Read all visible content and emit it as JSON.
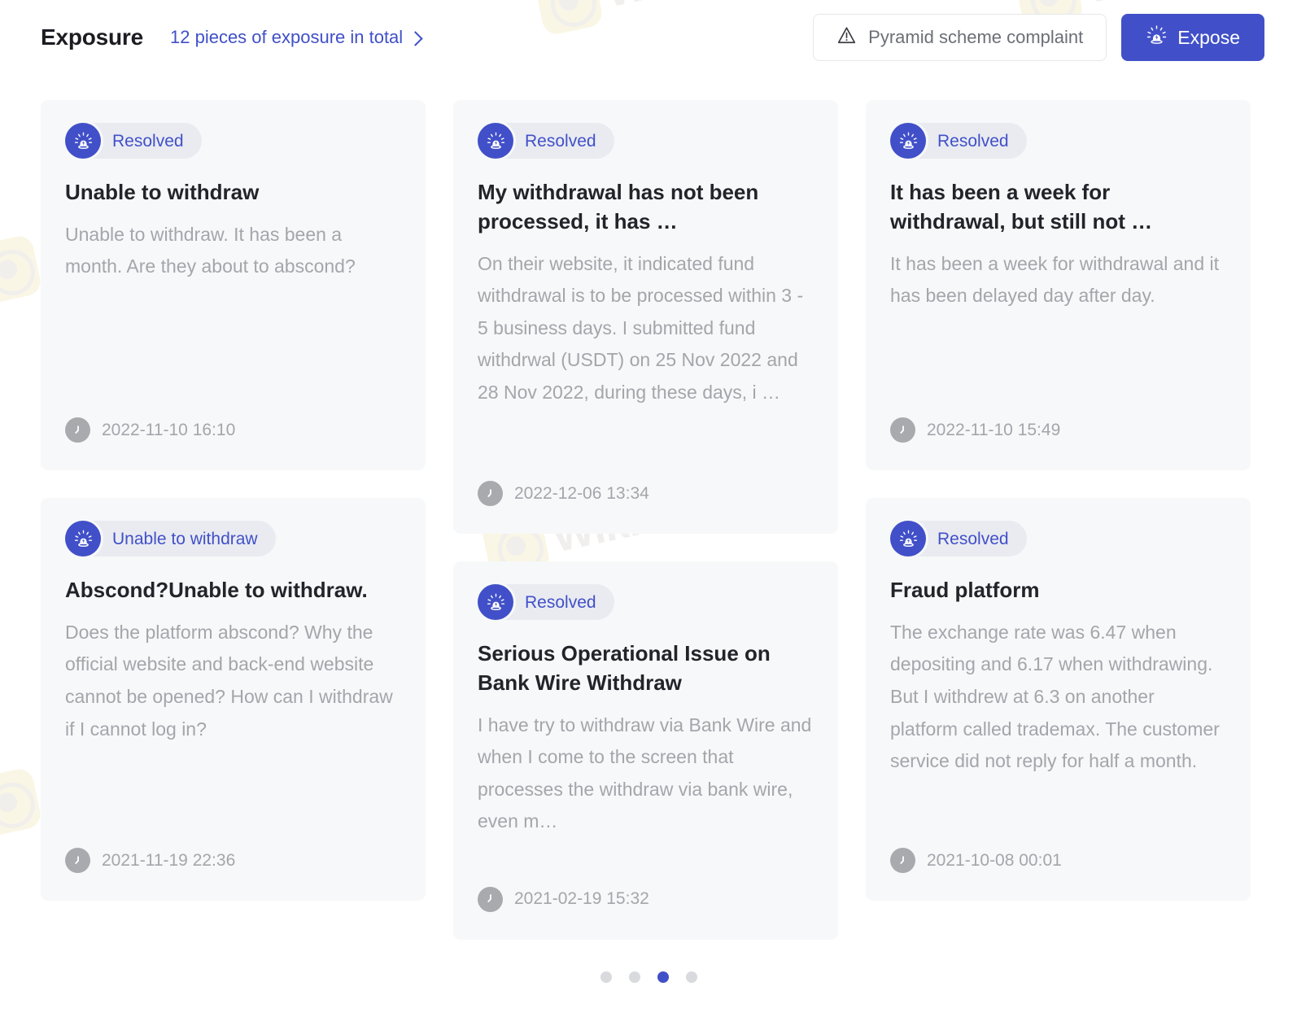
{
  "header": {
    "title": "Exposure",
    "total_link": "12 pieces of exposure in total",
    "chevron_icon": "chevron-right-icon",
    "pyramid_button": {
      "label": "Pyramid scheme complaint",
      "icon": "warning-triangle-icon"
    },
    "expose_button": {
      "label": "Expose",
      "icon": "siren-alarm-icon"
    }
  },
  "colors": {
    "accent": "#4150c8",
    "card_bg": "#f7f8f9",
    "badge_bg": "#e9ebf1",
    "muted_text": "#a3a6ab",
    "title_text": "#23242a",
    "page_bg": "#ffffff",
    "dot_inactive": "#d9dadd"
  },
  "cards": [
    {
      "badge": "Resolved",
      "badge_icon": "siren-alarm-icon",
      "title": "Unable to withdraw",
      "body": "Unable to withdraw. It has been a month. Are they about to abscond?",
      "time": "2022-11-10 16:10",
      "time_icon": "clock-icon"
    },
    {
      "badge": "Unable to withdraw",
      "badge_icon": "siren-alarm-icon",
      "title": "Abscond?Unable to withdraw.",
      "body": "Does the platform abscond? Why the official website and back-end website cannot be opened? How can I withdraw if I cannot log in?",
      "time": "2021-11-19 22:36",
      "time_icon": "clock-icon"
    },
    {
      "badge": "Resolved",
      "badge_icon": "siren-alarm-icon",
      "title": "My withdrawal has not been processed, it has …",
      "body": "On their website, it indicated fund withdrawal is to be processed within 3 - 5 business days. I submitted fund withdrwal (USDT) on 25 Nov 2022 and 28 Nov 2022, during these days, i …",
      "time": "2022-12-06 13:34",
      "time_icon": "clock-icon"
    },
    {
      "badge": "Resolved",
      "badge_icon": "siren-alarm-icon",
      "title": "Serious Operational Issue on Bank Wire Withdraw",
      "body": "I have try to withdraw via Bank Wire and when I come to the screen that processes the withdraw via bank wire, even m…",
      "time": "2021-02-19 15:32",
      "time_icon": "clock-icon"
    },
    {
      "badge": "Resolved",
      "badge_icon": "siren-alarm-icon",
      "title": "It has been a week for withdrawal, but still not …",
      "body": "It has been a week for withdrawal and it has been delayed day after day.",
      "time": "2022-11-10 15:49",
      "time_icon": "clock-icon"
    },
    {
      "badge": "Resolved",
      "badge_icon": "siren-alarm-icon",
      "title": "Fraud platform",
      "body": "The exchange rate was 6.47 when depositing and 6.17 when withdrawing. But I withdrew at 6.3 on another platform called trademax. The customer service did not reply for half a month.",
      "time": "2021-10-08 00:01",
      "time_icon": "clock-icon"
    }
  ],
  "pagination": {
    "total": 4,
    "active_index": 3
  },
  "watermark": {
    "text": "WikiFX"
  }
}
